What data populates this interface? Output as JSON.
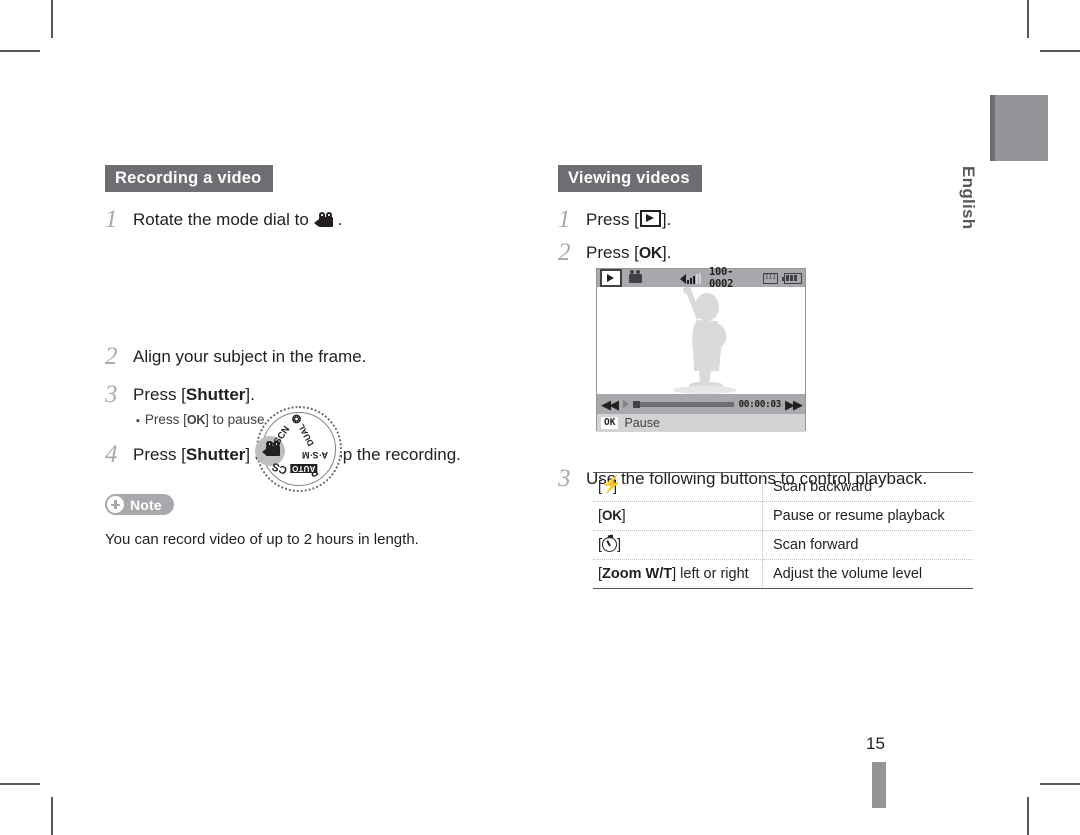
{
  "page": {
    "number": "15",
    "language_tab": "English"
  },
  "left_column": {
    "header": "Recording a video",
    "steps": [
      {
        "num": "1",
        "text_before": "Rotate the mode dial to ",
        "icon": "movie-camera-icon",
        "text_after": "."
      },
      {
        "num": "2",
        "text": "Align your subject in the frame."
      },
      {
        "num": "3",
        "text_before": "Press [",
        "bold": "Shutter",
        "text_after": "]."
      },
      {
        "num": "4",
        "text_before": "Press [",
        "bold": "Shutter",
        "text_after": "] again to stop the recording."
      }
    ],
    "sub_bullet": {
      "bullet": "▪",
      "text_before": "Press [",
      "key": "OK",
      "text_after": "] to pause or resume."
    },
    "mode_dial": {
      "labels": [
        "SCN",
        "DUAL",
        "A·S·M",
        "P",
        "AUTO",
        "CS",
        "movie-camera-icon",
        "star-icon"
      ],
      "selected": "movie-camera-icon"
    },
    "note": {
      "badge_label": "Note",
      "badge_icon": "plus-circle-icon",
      "body": "You can record video of up to 2 hours in length."
    }
  },
  "right_column": {
    "header": "Viewing videos",
    "steps": [
      {
        "num": "1",
        "text_before": "Press [",
        "icon": "playback-icon",
        "text_after": "]."
      },
      {
        "num": "2",
        "text_before": "Press [",
        "key": "OK",
        "text_after": "]."
      },
      {
        "num": "3",
        "text": "Use the following buttons to control playback."
      }
    ],
    "lcd": {
      "top_bar": {
        "playback_icon": "playback-icon",
        "video_icon": "movie-camera-icon",
        "volume_icon": "volume-icon",
        "file_number": "100-0002",
        "card_icon": "memory-card-icon",
        "battery_icon": "battery-full-icon"
      },
      "subject": "person-silhouette",
      "control_bar": {
        "rewind_icon": "scan-backward-icon",
        "play_icon": "play-icon",
        "timecode": "00:00:03",
        "forward_icon": "scan-forward-icon"
      },
      "footer": {
        "key": "OK",
        "action": "Pause"
      }
    },
    "playback_table": {
      "rows": [
        {
          "key_prefix": "[",
          "key_icon": "flash-icon",
          "key_suffix": "]",
          "key_text": "",
          "action": "Scan backward"
        },
        {
          "key_prefix": "[",
          "key_icon": "",
          "key_suffix": "]",
          "key_text": "OK",
          "action": "Pause or resume playback"
        },
        {
          "key_prefix": "[",
          "key_icon": "timer-icon",
          "key_suffix": "]",
          "key_text": "",
          "action": "Scan forward"
        },
        {
          "key_prefix": "[",
          "key_icon": "",
          "key_suffix": "] left or right",
          "key_text": "Zoom W/T",
          "action": "Adjust the volume level"
        }
      ]
    }
  },
  "colors": {
    "header_bg": "#6d6e71",
    "note_badge_bg": "#a7a9ac",
    "lcd_bar_bg": "#a7a9ac",
    "step_number": "#a7a9ac",
    "text": "#231f20"
  }
}
